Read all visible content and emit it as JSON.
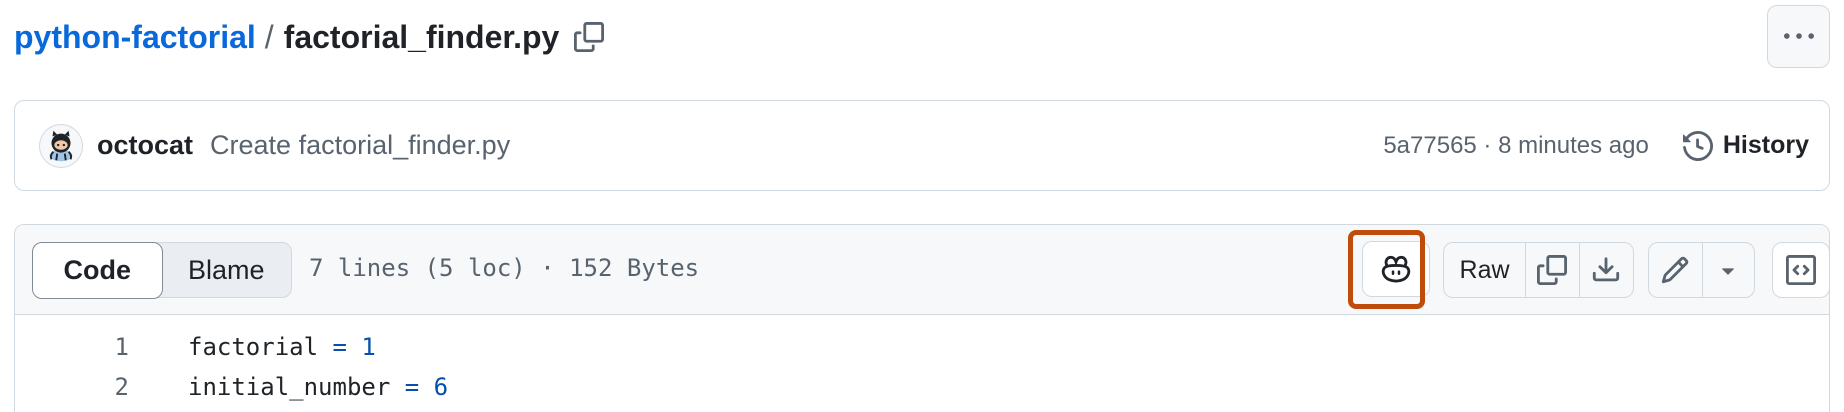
{
  "breadcrumb": {
    "repo": "python-factorial",
    "separator": "/",
    "file": "factorial_finder.py"
  },
  "commit": {
    "author": "octocat",
    "message": "Create factorial_finder.py",
    "meta": "5a77565 · 8 minutes ago",
    "history_label": "History"
  },
  "file_header": {
    "tabs": [
      {
        "label": "Code",
        "active": true
      },
      {
        "label": "Blame",
        "active": false
      }
    ],
    "info": "7 lines (5 loc) · 152 Bytes",
    "raw_label": "Raw"
  },
  "code_lines": [
    {
      "num": "1",
      "name": "factorial",
      "op": "=",
      "value": "1"
    },
    {
      "num": "2",
      "name": "initial_number",
      "op": "=",
      "value": "6"
    }
  ],
  "colors": {
    "link": "#0969da",
    "highlight": "#bf4c0a",
    "border": "#d1d9e0",
    "header_bg": "#f6f8fa",
    "code_literal": "#0550ae"
  },
  "icons": [
    "copy-icon",
    "kebab-horizontal-icon",
    "octocat-avatar",
    "history-icon",
    "copilot-icon",
    "download-icon",
    "pencil-icon",
    "triangle-down-icon",
    "code-square-icon"
  ]
}
